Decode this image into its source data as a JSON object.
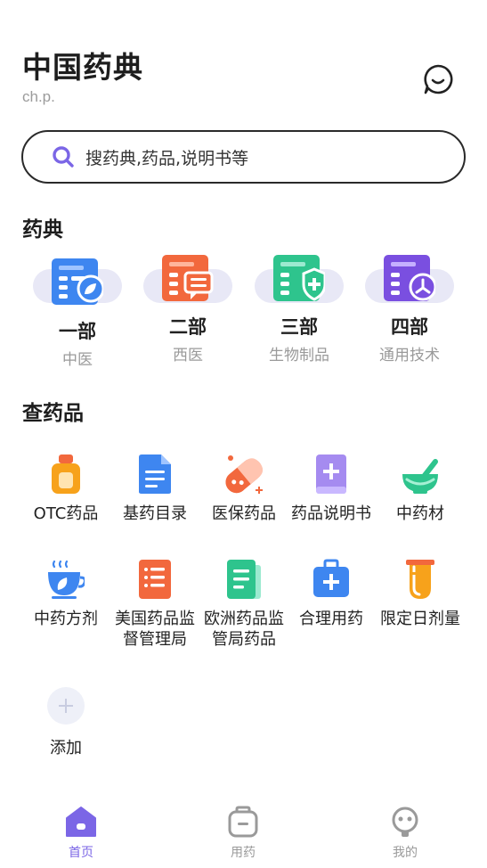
{
  "header": {
    "title": "中国药典",
    "subtitle": "ch.p."
  },
  "search": {
    "placeholder": "搜药典,药品,说明书等"
  },
  "pharmacopoeia": {
    "title": "药典",
    "items": [
      {
        "name": "一部",
        "sub": "中医",
        "icon": "document-leaf-icon",
        "color": "#3e86f0"
      },
      {
        "name": "二部",
        "sub": "西医",
        "icon": "document-chat-icon",
        "color": "#f2683d"
      },
      {
        "name": "三部",
        "sub": "生物制品",
        "icon": "document-shield-icon",
        "color": "#2ec48d"
      },
      {
        "name": "四部",
        "sub": "通用技术",
        "icon": "document-tools-icon",
        "color": "#7a4fe0"
      }
    ]
  },
  "drugs": {
    "title": "查药品",
    "items": [
      {
        "label": "OTC药品",
        "icon": "medicine-bottle-icon",
        "color": "#f7a21b"
      },
      {
        "label": "基药目录",
        "icon": "document-icon",
        "color": "#3e86f0"
      },
      {
        "label": "医保药品",
        "icon": "capsule-icon",
        "color": "#f2683d"
      },
      {
        "label": "药品说明书",
        "icon": "book-plus-icon",
        "color": "#a58bf0"
      },
      {
        "label": "中药材",
        "icon": "mortar-pestle-icon",
        "color": "#2ec48d"
      },
      {
        "label": "中药方剂",
        "icon": "herbal-bowl-icon",
        "color": "#3e86f0"
      },
      {
        "label": "美国药品监督管理局",
        "icon": "list-document-icon",
        "color": "#f2683d"
      },
      {
        "label": "欧洲药品监管局药品",
        "icon": "green-document-icon",
        "color": "#2ec48d"
      },
      {
        "label": "合理用药",
        "icon": "medical-kit-icon",
        "color": "#3e86f0"
      },
      {
        "label": "限定日剂量",
        "icon": "test-tube-icon",
        "color": "#f7a21b"
      }
    ],
    "add_label": "添加"
  },
  "tabbar": {
    "tabs": [
      {
        "label": "首页",
        "active": true
      },
      {
        "label": "用药",
        "active": false
      },
      {
        "label": "我的",
        "active": false
      }
    ],
    "accent": "#7b66e6"
  }
}
